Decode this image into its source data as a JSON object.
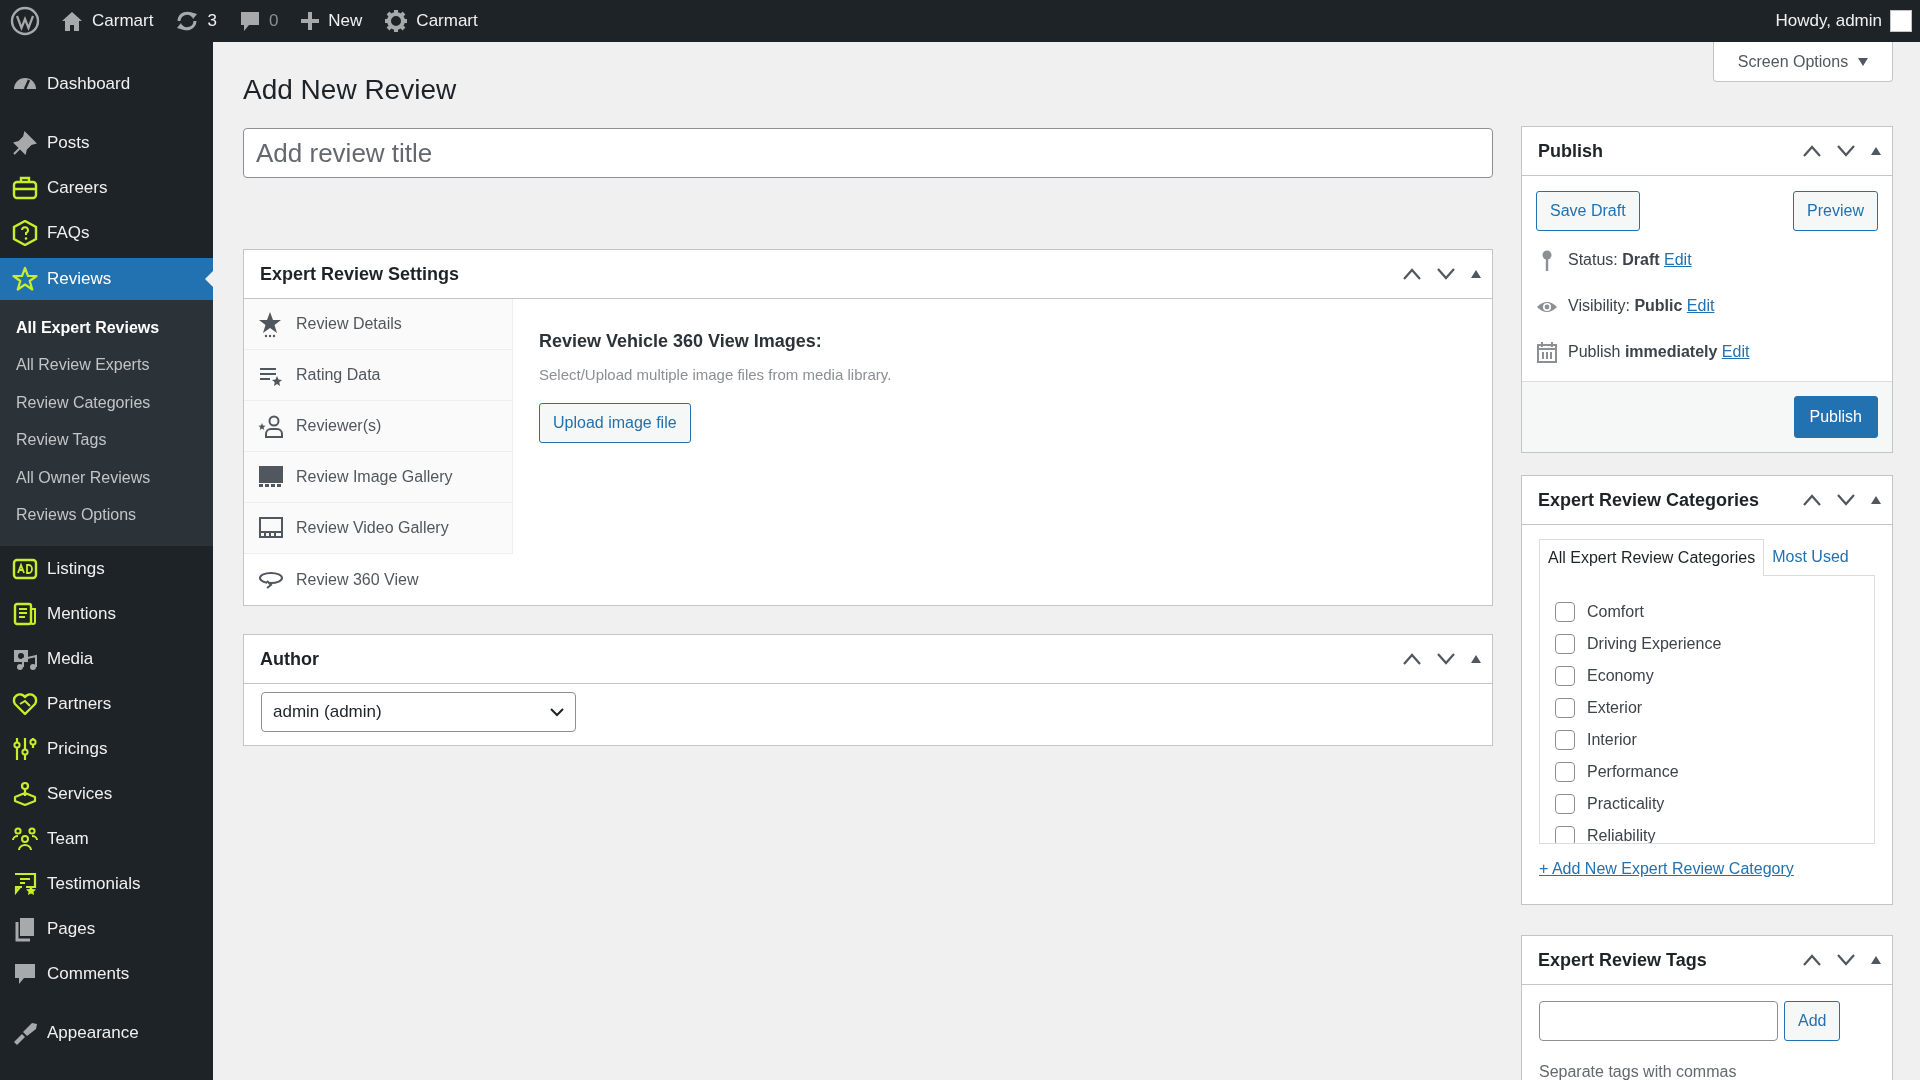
{
  "admin_bar": {
    "site_name": "Carmart",
    "updates": "3",
    "comments": "0",
    "new": "New",
    "customizer": "Carmart",
    "greeting": "Howdy, admin"
  },
  "sidebar": {
    "items": [
      {
        "label": "Dashboard",
        "selected": false
      },
      {
        "label": "Posts",
        "selected": false
      },
      {
        "label": "Careers",
        "selected": false
      },
      {
        "label": "FAQs",
        "selected": false
      },
      {
        "label": "Reviews",
        "selected": true,
        "children": [
          {
            "label": "All Expert Reviews",
            "selected": true
          },
          {
            "label": "All Review Experts",
            "selected": false
          },
          {
            "label": "Review Categories",
            "selected": false
          },
          {
            "label": "Review Tags",
            "selected": false
          },
          {
            "label": "All Owner Reviews",
            "selected": false
          },
          {
            "label": "Reviews Options",
            "selected": false
          }
        ]
      },
      {
        "label": "Listings",
        "selected": false
      },
      {
        "label": "Mentions",
        "selected": false
      },
      {
        "label": "Media",
        "selected": false
      },
      {
        "label": "Partners",
        "selected": false
      },
      {
        "label": "Pricings",
        "selected": false
      },
      {
        "label": "Services",
        "selected": false
      },
      {
        "label": "Team",
        "selected": false
      },
      {
        "label": "Testimonials",
        "selected": false
      },
      {
        "label": "Pages",
        "selected": false
      },
      {
        "label": "Comments",
        "selected": false
      },
      {
        "label": "Appearance",
        "selected": false
      }
    ]
  },
  "page_title": "Add New Review",
  "screen_options": "Screen Options",
  "title_field": {
    "placeholder": "Add review title"
  },
  "settings_box": {
    "title": "Expert Review Settings",
    "tabs": [
      {
        "label": "Review Details",
        "selected": false
      },
      {
        "label": "Rating Data",
        "selected": false
      },
      {
        "label": "Reviewer(s)",
        "selected": false
      },
      {
        "label": "Review Image Gallery",
        "selected": false
      },
      {
        "label": "Review Video Gallery",
        "selected": false
      },
      {
        "label": "Review 360 View",
        "selected": true
      }
    ],
    "panel": {
      "heading": "Review Vehicle 360 View Images:",
      "description": "Select/Upload multiple image files from media library.",
      "button": "Upload image file"
    }
  },
  "author_box": {
    "title": "Author",
    "select": {
      "value": "admin (admin)"
    }
  },
  "publish_box": {
    "title": "Publish",
    "save_draft": "Save Draft",
    "preview": "Preview",
    "lines": [
      {
        "text": "Status: **Draft**",
        "link": "Edit"
      },
      {
        "text": "Visibility: **Public**",
        "link": "Edit"
      },
      {
        "text": "Publish **immediately**",
        "link": "Edit"
      }
    ],
    "publish_button": "Publish"
  },
  "categories_box": {
    "title": "Expert Review Categories",
    "tabs": [
      {
        "label": "All Expert Review Categories",
        "selected": true
      },
      {
        "label": "Most Used",
        "selected": false
      }
    ],
    "items": [
      {
        "label": "Comfort",
        "checked": false
      },
      {
        "label": "Driving Experience",
        "checked": false
      },
      {
        "label": "Economy",
        "checked": false
      },
      {
        "label": "Exterior",
        "checked": false
      },
      {
        "label": "Interior",
        "checked": false
      },
      {
        "label": "Performance",
        "checked": false
      },
      {
        "label": "Practicality",
        "checked": false
      },
      {
        "label": "Reliability",
        "checked": false
      }
    ],
    "add_link": "+ Add New Expert Review Category"
  },
  "tags_box": {
    "title": "Expert Review Tags",
    "button": "Add",
    "hint": "Separate tags with commas"
  }
}
